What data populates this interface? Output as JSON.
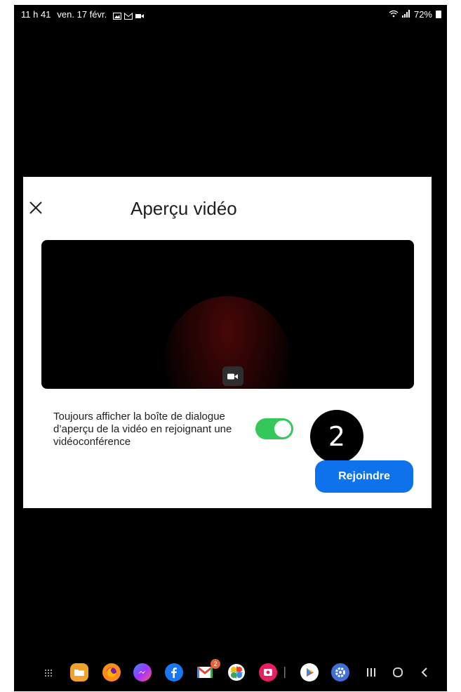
{
  "status_bar": {
    "time": "11 h 41",
    "date": "ven. 17 févr.",
    "battery": "72%",
    "notification_icons": [
      "gallery-icon",
      "gmail-icon",
      "video-icon"
    ],
    "signal_icons": [
      "wifi-icon",
      "signal-icon",
      "battery-icon"
    ]
  },
  "dialog": {
    "title": "Aperçu vidéo",
    "toggle_label": "Toujours afficher la boîte de dialogue d’aperçu de la vidéo en rejoignant une vidéoconférence",
    "toggle_on": true,
    "join_label": "Rejoindre",
    "step_badge": "2"
  },
  "taskbar": {
    "apps": [
      "apps-grid-icon",
      "files-icon",
      "firefox-icon",
      "messenger-icon",
      "facebook-icon",
      "gmail-icon",
      "photos-icon",
      "screen-recorder-icon",
      "play-store-icon",
      "settings-icon"
    ],
    "gmail_badge": "2",
    "nav": [
      "recents-icon",
      "home-icon",
      "back-icon"
    ]
  },
  "colors": {
    "accent": "#0e72ed",
    "toggle": "#34c759",
    "background": "#000000"
  }
}
